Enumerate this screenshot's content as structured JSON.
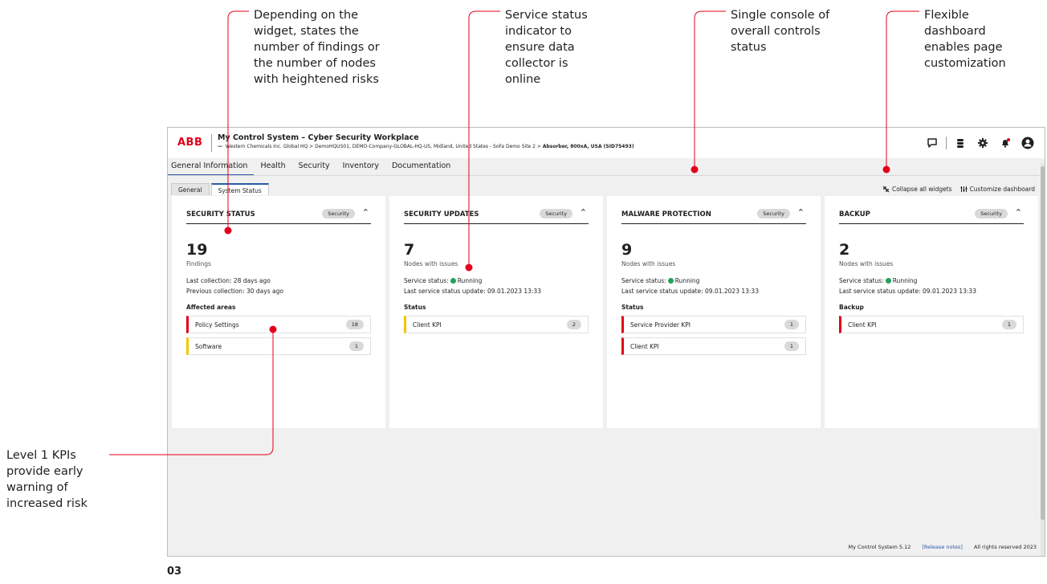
{
  "annotations": {
    "findings": "Depending on the\nwidget, states the\nnumber of findings or\nthe number of nodes\nwith heightened risks",
    "service_status": "Service status\nindicator to\nensure data\ncollector is\nonline",
    "single_console": "Single console of\noverall controls\nstatus",
    "flexible_dashboard": "Flexible\ndashboard\nenables page\ncustomization",
    "level1_kpis": "Level 1 KPIs\nprovide early\nwarning of\nincreased risk"
  },
  "page_number": "03",
  "colors": {
    "accent": "#e2001a",
    "brand": "#e2001a",
    "tab_active": "#2a5aa8",
    "running": "#21a35a",
    "warning": "#f5c400"
  },
  "app": {
    "logo": "ABB",
    "title": "My Control System – Cyber Security Workplace",
    "breadcrumb_dash": "—",
    "breadcrumb": "Western Chemicals Inc. Global HQ  >  DemoHQUS01, DEMO-Company-GLOBAL-HQ-US, Midland, United States - SoFa Demo Site 2  >",
    "breadcrumb_last": "Absorber, 800xA, USA (SID75493)",
    "icons": [
      "chat-icon",
      "database-icon",
      "gear-icon",
      "notification-bell-icon",
      "user-avatar-icon"
    ]
  },
  "nav": {
    "tabs": [
      {
        "label": "General Information",
        "active": true
      },
      {
        "label": "Health"
      },
      {
        "label": "Security"
      },
      {
        "label": "Inventory"
      },
      {
        "label": "Documentation"
      }
    ],
    "subtabs": [
      {
        "label": "General"
      },
      {
        "label": "System Status",
        "active": true
      }
    ]
  },
  "actions": {
    "collapse": "Collapse all widgets",
    "customize": "Customize dashboard"
  },
  "widgets": [
    {
      "title": "SECURITY STATUS",
      "tag": "Security",
      "toggle": "⌃",
      "count": "19",
      "unit": "Findings",
      "line1": "Last collection: 28 days ago",
      "line2": "Previous collection: 30 days ago",
      "section": "Affected areas",
      "kpis": [
        {
          "label": "Policy Settings",
          "value": "18",
          "severity": "red"
        },
        {
          "label": "Software",
          "value": "1",
          "severity": "amber"
        }
      ]
    },
    {
      "title": "SECURITY UPDATES",
      "tag": "Security",
      "toggle": "⌃",
      "count": "7",
      "unit": "Nodes with issues",
      "status_label": "Service status:",
      "status_value": "Running",
      "line2": "Last service status update: 09.01.2023 13:33",
      "section": "Status",
      "kpis": [
        {
          "label": "Client KPI",
          "value": "2",
          "severity": "amber"
        }
      ]
    },
    {
      "title": "MALWARE PROTECTION",
      "tag": "Security",
      "toggle": "⌃",
      "count": "9",
      "unit": "Nodes with issues",
      "status_label": "Service status:",
      "status_value": "Running",
      "line2": "Last service status update: 09.01.2023 13:33",
      "section": "Status",
      "kpis": [
        {
          "label": "Service Provider KPI",
          "value": "1",
          "severity": "red"
        },
        {
          "label": "Client KPI",
          "value": "1",
          "severity": "red"
        }
      ]
    },
    {
      "title": "BACKUP",
      "tag": "Security",
      "toggle": "⌃",
      "count": "2",
      "unit": "Nodes with issues",
      "status_label": "Service status:",
      "status_value": "Running",
      "line2": "Last service status update: 09.01.2023 13:33",
      "section": "Backup",
      "kpis": [
        {
          "label": "Client KPI",
          "value": "1",
          "severity": "red"
        }
      ]
    }
  ],
  "footer": {
    "version": "My Control System 5.12",
    "release_notes": "[Release notes]",
    "rights": "All rights reserved 2023"
  }
}
